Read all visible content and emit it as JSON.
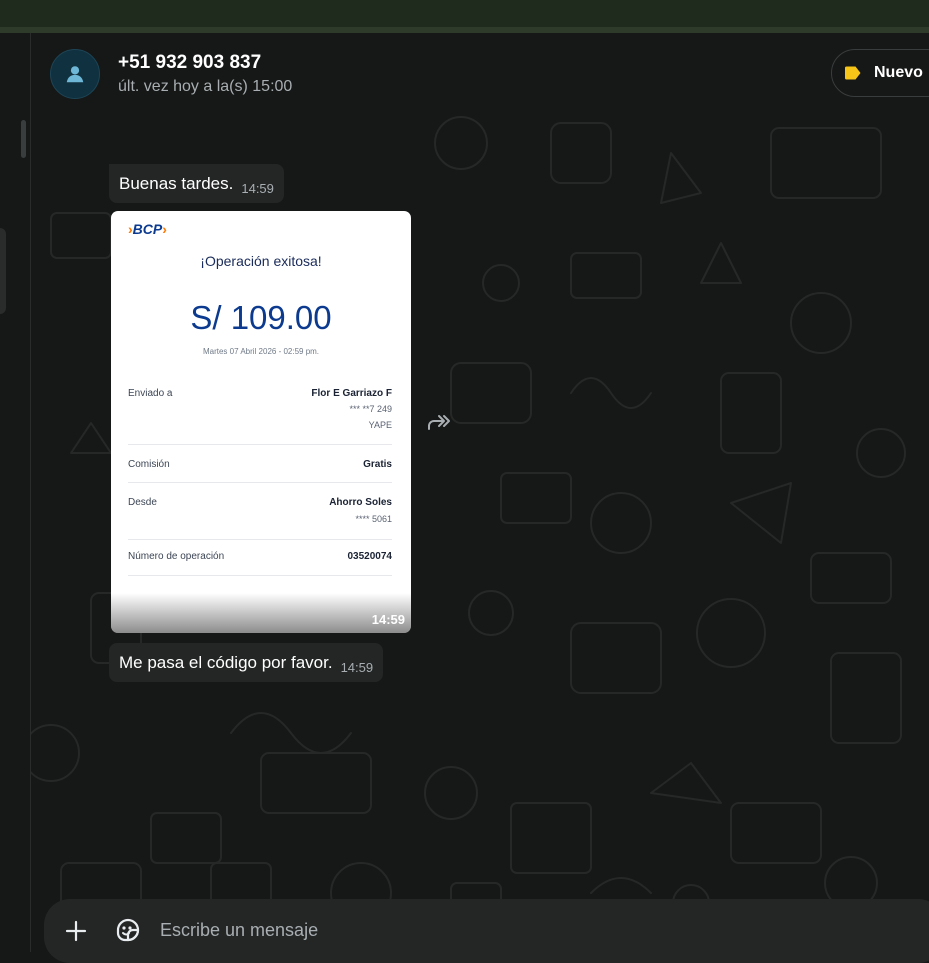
{
  "header": {
    "contact_name": "+51 932 903 837",
    "status": "últ. vez hoy a la(s) 15:00",
    "label_button": "Nuevo"
  },
  "messages": [
    {
      "text": "Buenas tardes.",
      "time": "14:59"
    },
    {
      "type": "image",
      "time": "14:59"
    },
    {
      "text": "Me pasa el código por favor.",
      "time": "14:59"
    }
  ],
  "receipt": {
    "brand": "BCP",
    "title": "¡Operación exitosa!",
    "amount": "S/ 109.00",
    "date": "Martes 07 Abril 2026 - 02:59 pm.",
    "sent_to_label": "Enviado a",
    "sent_to_name": "Flor E Garriazo F",
    "sent_to_phone": "*** **7 249",
    "sent_to_app": "YAPE",
    "commission_label": "Comisión",
    "commission_value": "Gratis",
    "from_label": "Desde",
    "from_account": "Ahorro Soles",
    "from_number": "**** 5061",
    "operation_label": "Número de operación",
    "operation_number": "03520074"
  },
  "composer": {
    "placeholder": "Escribe un mensaje"
  },
  "colors": {
    "label_tag": "#f7c518",
    "bank_blue": "#0b3a8f",
    "bank_orange": "#ff7800"
  },
  "icons": {
    "avatar": "person-icon",
    "label": "tag-icon",
    "forward": "forward-icon",
    "attach": "plus-icon",
    "sticker": "sticker-icon"
  }
}
